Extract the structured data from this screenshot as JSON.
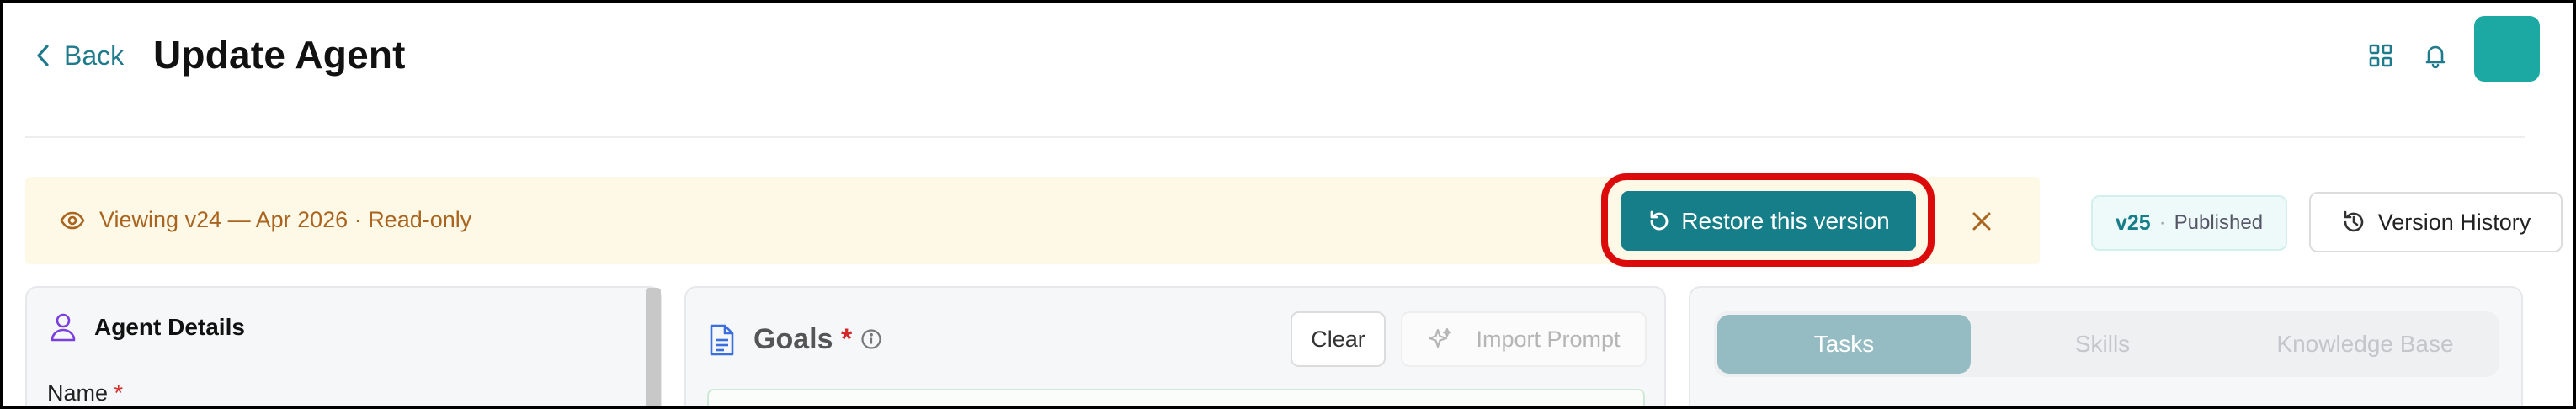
{
  "header": {
    "back_label": "Back",
    "title": "Update Agent",
    "icons": [
      "grid-icon",
      "bell-icon"
    ]
  },
  "banner": {
    "text": "Viewing v24 — Apr 2026 · Read-only",
    "restore_label": "Restore this version"
  },
  "version": {
    "number": "v25",
    "separator": "·",
    "status": "Published",
    "history_label": "Version History"
  },
  "agent_details": {
    "title": "Agent Details",
    "name_label": "Name",
    "required_marker": "*"
  },
  "goals": {
    "title": "Goals",
    "required_marker": "*",
    "clear_label": "Clear",
    "import_label": "Import Prompt"
  },
  "tabs": [
    {
      "label": "Tasks",
      "active": true
    },
    {
      "label": "Skills",
      "active": false
    },
    {
      "label": "Knowledge Base",
      "active": false
    }
  ],
  "colors": {
    "accent": "#167e88",
    "banner_bg": "#fef8e6",
    "banner_text": "#a9651f",
    "highlight": "#dc0b0b",
    "avatar": "#1ca9a3"
  }
}
